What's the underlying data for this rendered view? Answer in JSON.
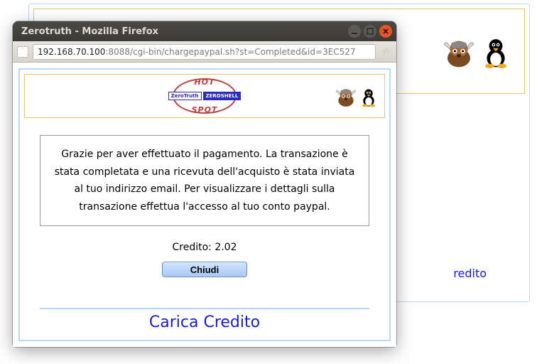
{
  "window": {
    "title": "Zerotruth - Mozilla Firefox",
    "url_host": "192.168.70.100",
    "url_rest": ":8088/cgi-bin/chargepaypal.sh?st=Completed&id=3EC527"
  },
  "logo": {
    "top": "HOT",
    "bottom": "SPOT",
    "badge1": "ZeroTruth",
    "badge2": "ZEROSHELL"
  },
  "message": {
    "thank_you": "Grazie per aver effettuato il pagamento. La transazione è stata completata e una ricevuta dell'acquisto è stata inviata al tuo indirizzo email. Per visualizzare i dettagli sulla transazione effettua l'accesso al tuo conto paypal."
  },
  "credit": {
    "label": "Credito:",
    "value": "2.02"
  },
  "buttons": {
    "close": "Chiudi"
  },
  "links": {
    "carica": "Carica Credito",
    "bg_credito": "redito"
  }
}
